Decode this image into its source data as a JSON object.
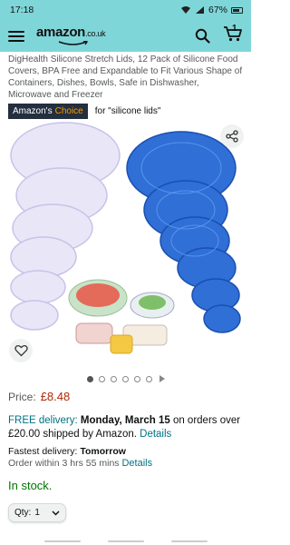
{
  "status_bar": {
    "time": "17:18",
    "battery": "67%"
  },
  "header": {
    "logo_text": "amazon",
    "logo_domain": ".co.uk",
    "cart_count": "1",
    "background_color": "#7fd6d9"
  },
  "product": {
    "title": "DigHealth Silicone Stretch Lids, 12 Pack of Silicone Food Covers, BPA Free and Expandable to Fit Various Shape of Containers, Dishes, Bowls, Safe in Dishwasher, Microwave and Freezer",
    "choice_badge_prefix": "Amazon's",
    "choice_badge_word": "Choice",
    "choice_for": "for \"silicone lids\""
  },
  "gallery": {
    "image_count": 6,
    "active_index": 0,
    "has_video": true
  },
  "price": {
    "label": "Price:",
    "value": "£8.48"
  },
  "delivery": {
    "free_label": "FREE delivery:",
    "date": "Monday, March 15",
    "condition": "on orders over £20.00 shipped by Amazon.",
    "details_link": "Details"
  },
  "fastest": {
    "label": "Fastest delivery:",
    "date": "Tomorrow"
  },
  "order_within": {
    "text": "Order within 3 hrs 55 mins",
    "details_link": "Details"
  },
  "stock": "In stock.",
  "quantity": {
    "label": "Qty:",
    "value": "1"
  },
  "icons": {
    "menu": "hamburger-menu-icon",
    "search": "search-icon",
    "cart": "cart-icon",
    "share": "share-icon",
    "wishlist": "heart-icon"
  }
}
